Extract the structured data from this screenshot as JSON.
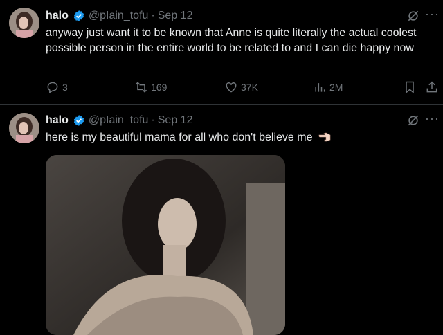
{
  "tweets": [
    {
      "name": "halo",
      "handle": "@pIain_tofu",
      "separator": "·",
      "date": "Sep 12",
      "text": "anyway just want it to be known that Anne is quite literally the actual coolest possible person in the entire world to be related to and I can die happy now",
      "replies": "3",
      "retweets": "169",
      "likes": "37K",
      "views": "2M"
    },
    {
      "name": "halo",
      "handle": "@pIain_tofu",
      "separator": "·",
      "date": "Sep 12",
      "text": "here is my beautiful mama for all who don't believe me",
      "emoji": "pointing-left-hand-emoji"
    }
  ],
  "colors": {
    "background": "#000000",
    "verified": "#1d9bf0",
    "muted": "#71767b",
    "text": "#e7e9ea"
  },
  "icons": [
    "verified-badge-icon",
    "grok-icon",
    "more-icon",
    "reply-icon",
    "retweet-icon",
    "like-icon",
    "views-icon",
    "bookmark-icon",
    "share-icon"
  ]
}
